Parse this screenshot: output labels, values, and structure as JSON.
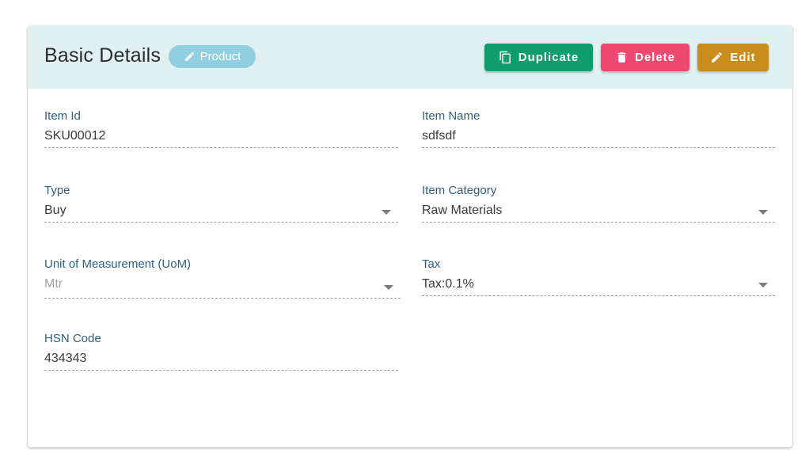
{
  "header": {
    "title": "Basic Details",
    "chip_label": "Product",
    "buttons": {
      "duplicate": "Duplicate",
      "delete": "Delete",
      "edit": "Edit"
    },
    "colors": {
      "duplicate": "#0f9d6e",
      "delete": "#ee4a71",
      "edit": "#c98d1c",
      "chip": "#90cfe0",
      "header_bg": "#e1f0f0"
    }
  },
  "fields": {
    "item_id": {
      "label": "Item Id",
      "value": "SKU00012"
    },
    "item_name": {
      "label": "Item Name",
      "value": "sdfsdf"
    },
    "type": {
      "label": "Type",
      "value": "Buy"
    },
    "item_category": {
      "label": "Item Category",
      "value": "Raw Materials"
    },
    "uom": {
      "label": "Unit of Measurement (UoM)",
      "value": "Mtr"
    },
    "tax": {
      "label": "Tax",
      "value": "Tax:0.1%"
    },
    "hsn_code": {
      "label": "HSN Code",
      "value": "434343"
    }
  },
  "icons": {
    "chip": "pencil-icon",
    "duplicate": "copy-icon",
    "delete": "trash-icon",
    "edit": "pencil-icon",
    "select": "chevron-down-icon"
  }
}
